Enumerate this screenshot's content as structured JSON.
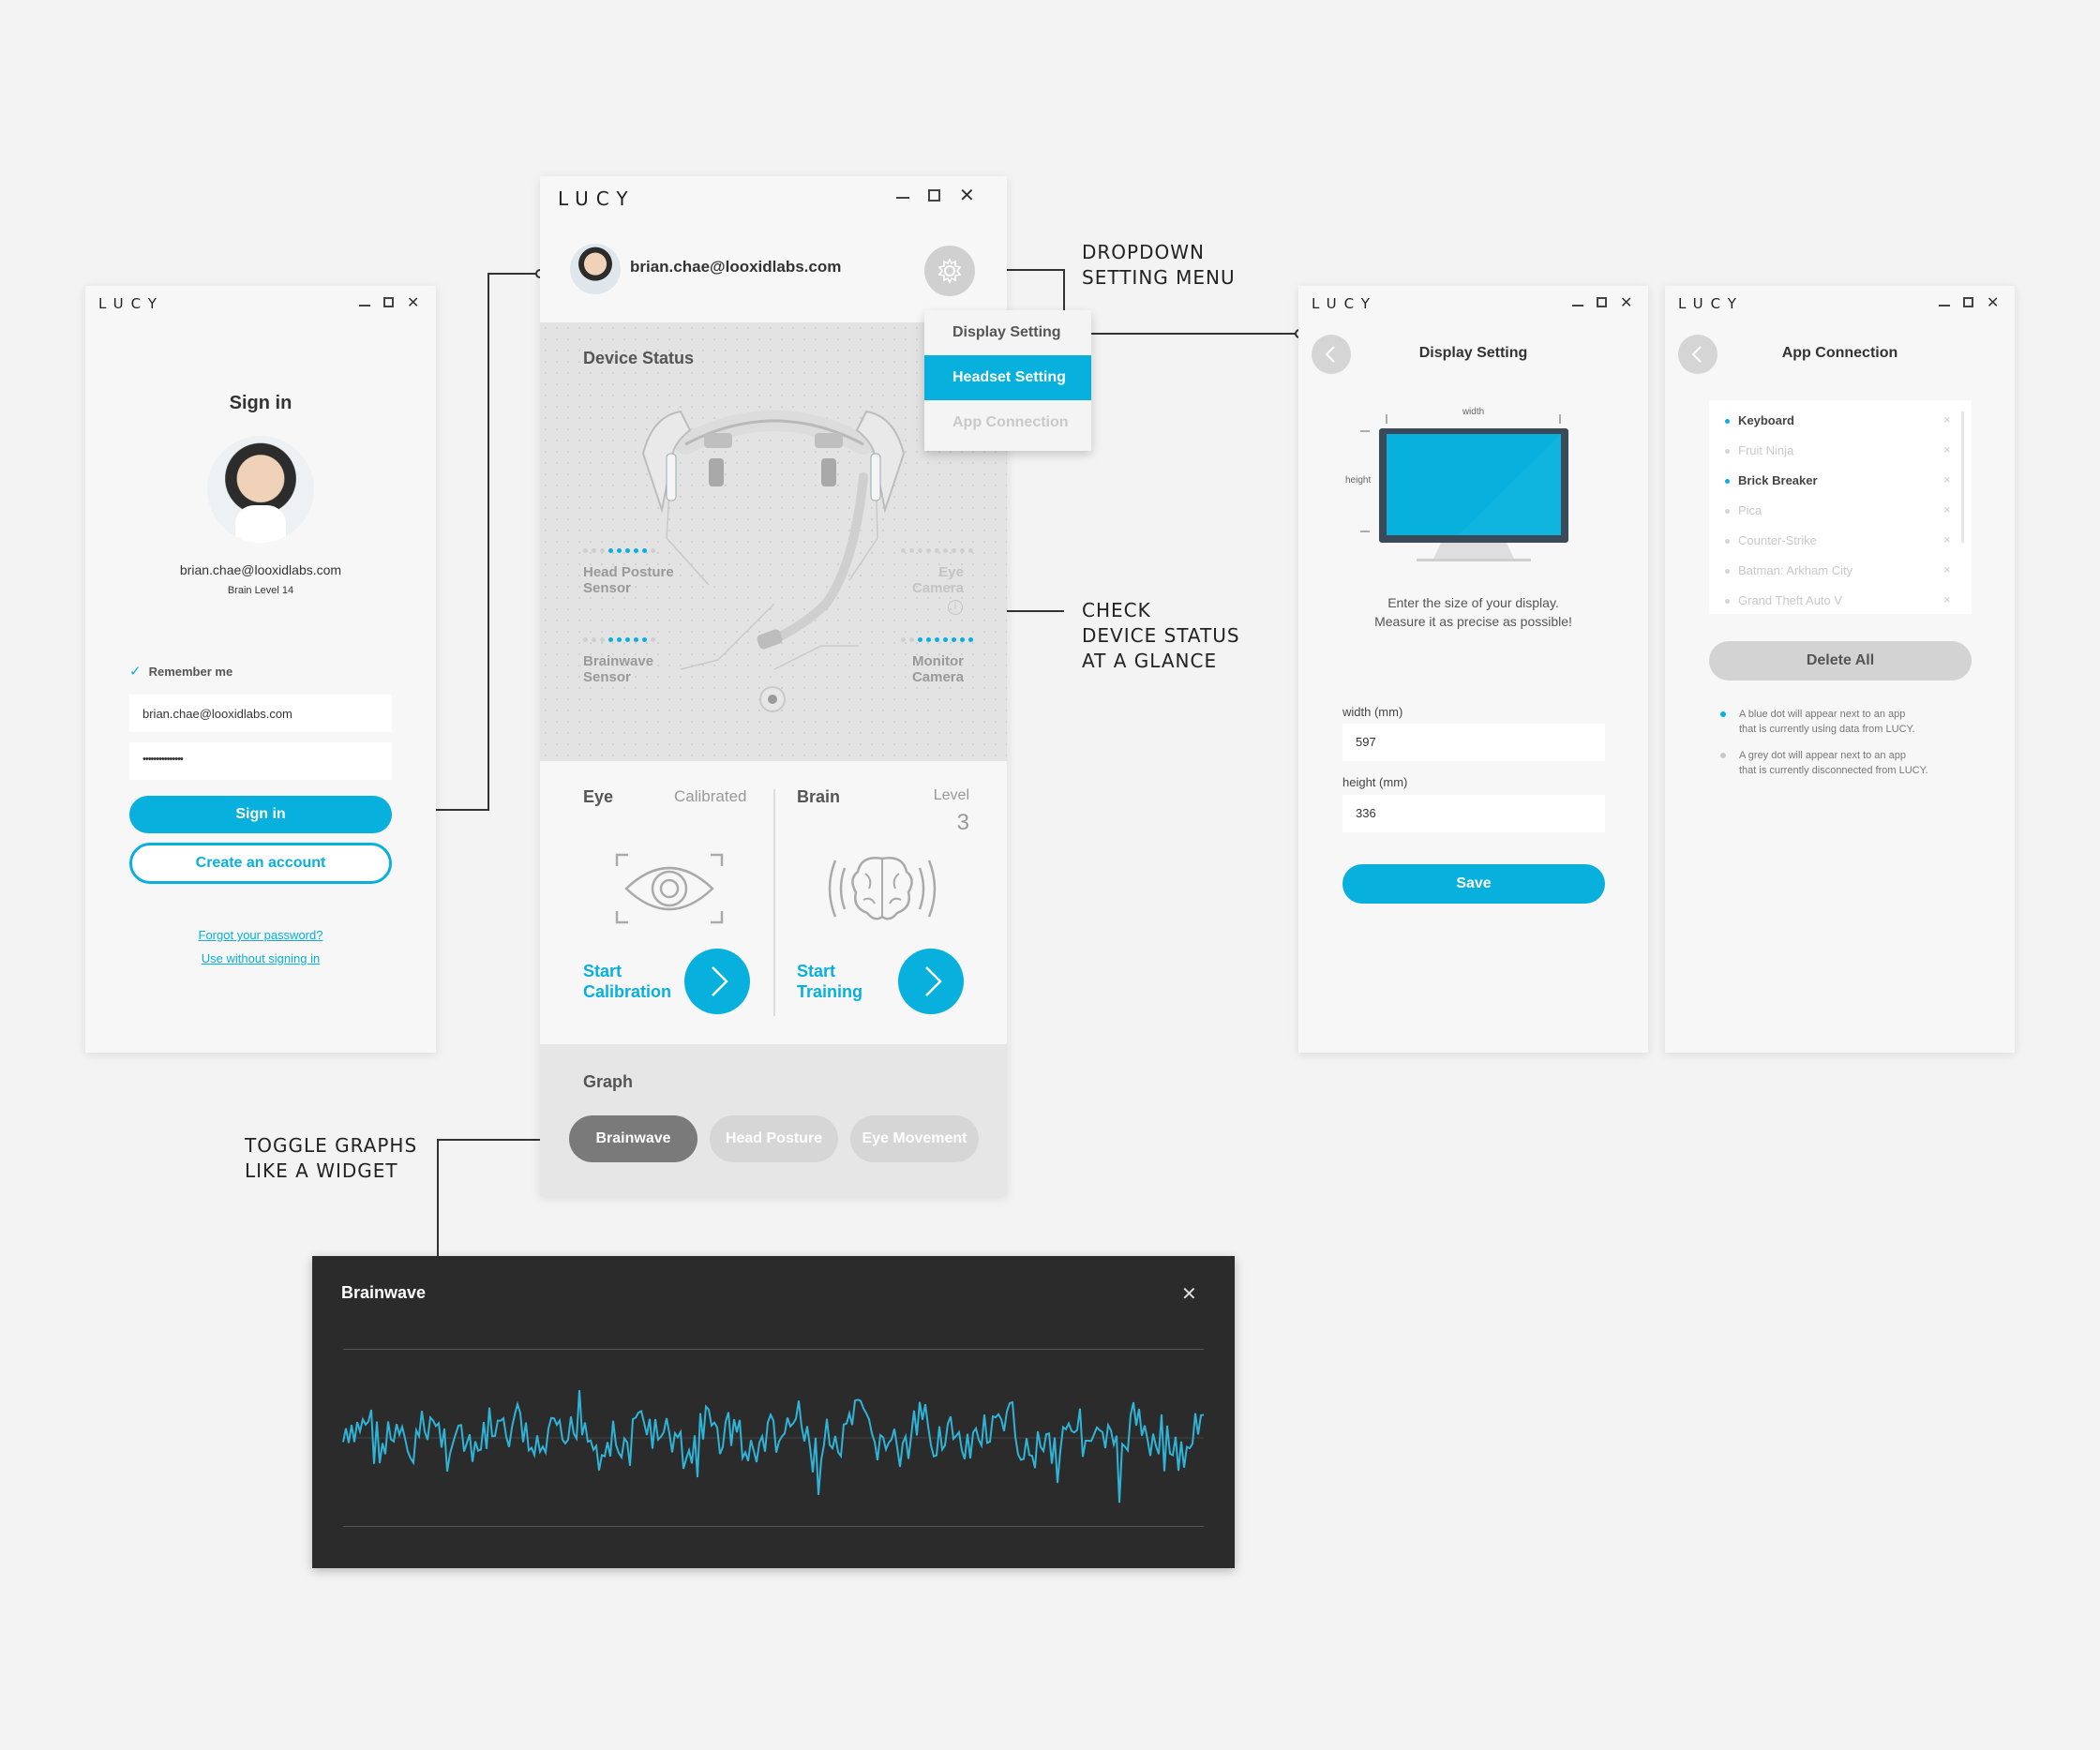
{
  "annotations": {
    "dropdown": "DROPDOWN\nSETTING MENU",
    "device_status": "CHECK\nDEVICE STATUS\nAT A GLANCE",
    "toggle_graphs": "TOGGLE GRAPHS\nLIKE A WIDGET"
  },
  "app_name": "LUCY",
  "signin": {
    "title": "Sign in",
    "email": "brian.chae@looxidlabs.com",
    "brain_level": "Brain Level 14",
    "remember_me": "Remember me",
    "email_value": "brian.chae@looxidlabs.com",
    "password_value": "•••••••••••••••",
    "signin_button": "Sign in",
    "create_account_button": "Create an account",
    "forgot_password": "Forgot your password?",
    "use_without": "Use without signing in"
  },
  "main": {
    "user_email": "brian.chae@looxidlabs.com",
    "dropdown": {
      "items": [
        "Display Setting",
        "Headset Setting",
        "App Connection"
      ],
      "selected": "Headset Setting"
    },
    "device_status_title": "Device Status",
    "sensors": {
      "head_posture": "Head Posture\nSensor",
      "brainwave": "Brainwave\nSensor",
      "eye_camera": "Eye\nCamera",
      "monitor_camera": "Monitor\nCamera"
    },
    "eye": {
      "title": "Eye",
      "status": "Calibrated",
      "action": "Start\nCalibration"
    },
    "brain": {
      "title": "Brain",
      "level_label": "Level",
      "level_value": "3",
      "action": "Start\nTraining"
    },
    "graph_title": "Graph",
    "graph_tabs": [
      "Brainwave",
      "Head Posture",
      "Eye Movement"
    ],
    "graph_active": "Brainwave"
  },
  "display_setting": {
    "title": "Display Setting",
    "width_label": "width",
    "height_label": "height",
    "instruction": "Enter the size of your display.\nMeasure it as precise as possible!",
    "width_field_label": "width (mm)",
    "width_value": "597",
    "height_field_label": "height (mm)",
    "height_value": "336",
    "save_button": "Save"
  },
  "app_connection": {
    "title": "App Connection",
    "apps": [
      {
        "name": "Keyboard",
        "connected": true
      },
      {
        "name": "Fruit Ninja",
        "connected": false
      },
      {
        "name": "Brick Breaker",
        "connected": true
      },
      {
        "name": "Pica",
        "connected": false
      },
      {
        "name": "Counter-Strike",
        "connected": false
      },
      {
        "name": "Batman: Arkham City",
        "connected": false
      },
      {
        "name": "Grand Theft Auto V",
        "connected": false
      }
    ],
    "delete_all_button": "Delete All",
    "notes": [
      "A blue dot will appear next to an app\nthat is currently using data from LUCY.",
      "A grey dot will appear next to an app\nthat is currently disconnected from LUCY."
    ]
  },
  "brainwave_widget": {
    "title": "Brainwave",
    "line_color": "#2fb4d8",
    "background": "#2b2b2b"
  },
  "colors": {
    "accent": "#07b0dd",
    "background": "#f3f3f3"
  }
}
